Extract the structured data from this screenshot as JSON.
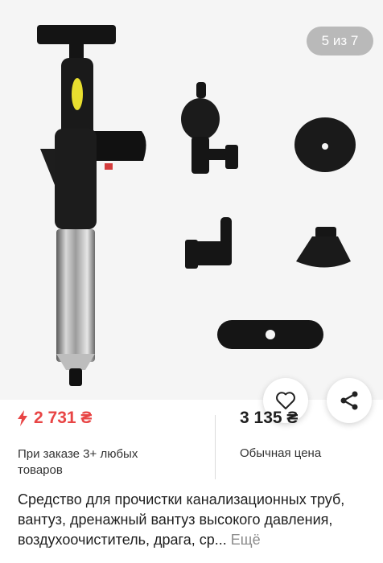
{
  "gallery": {
    "counter": "5 из 7",
    "like_icon": "heart-icon",
    "share_icon": "share-icon"
  },
  "prices": {
    "promo_icon": "lightning-icon",
    "promo_price": "2 731 ₴",
    "promo_note": "При заказе 3+ любых товаров",
    "regular_price": "3 135 ₴",
    "regular_note": "Обычная цена"
  },
  "product": {
    "description": "Средство для прочистки канализационных труб, вантуз, дренажный вантуз высокого давления, воздухоочиститель, драга, ср...",
    "more_label": "Ещё"
  },
  "colors": {
    "accent": "#e84545",
    "background": "#ffffff",
    "gallery_bg": "#f5f5f5"
  }
}
